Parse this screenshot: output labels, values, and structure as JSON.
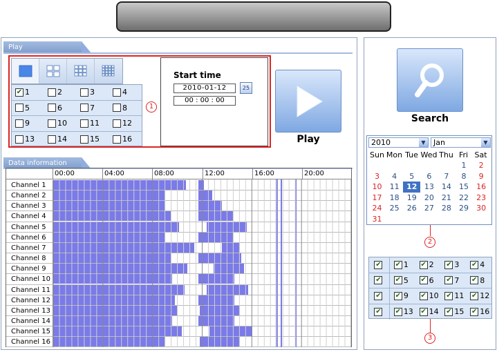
{
  "play_panel": {
    "tab_label": "Play",
    "channels": [
      "1",
      "2",
      "3",
      "4",
      "5",
      "6",
      "7",
      "8",
      "9",
      "10",
      "11",
      "12",
      "13",
      "14",
      "15",
      "16"
    ],
    "channel_checked": [
      true,
      false,
      false,
      false,
      false,
      false,
      false,
      false,
      false,
      false,
      false,
      false,
      false,
      false,
      false,
      false
    ],
    "layout_options": [
      "single-layout-icon",
      "quad-layout-icon",
      "nine-layout-icon",
      "sixteen-layout-icon"
    ],
    "start_time_label": "Start time",
    "start_date": "2010-01-12",
    "start_time": "00 : 00 : 00",
    "calendar_button_label": "25",
    "play_label": "Play",
    "callout_1": "1"
  },
  "data_info": {
    "tab_label": "Data information",
    "hours": [
      "00:00",
      "04:00",
      "08:00",
      "12:00",
      "16:00",
      "20:00"
    ],
    "channels": [
      "Channel 1",
      "Channel 2",
      "Channel 3",
      "Channel 4",
      "Channel 5",
      "Channel 6",
      "Channel 7",
      "Channel 8",
      "Channel 9",
      "Channel 10",
      "Channel 11",
      "Channel 12",
      "Channel 13",
      "Channel 14",
      "Channel 15",
      "Channel 16"
    ],
    "bar_color": "#7a7ae8"
  },
  "right_panel": {
    "search_label": "Search",
    "year": "2010",
    "month": "Jan",
    "weekdays": [
      "Sun",
      "Mon",
      "Tue",
      "Wed",
      "Thu",
      "Fri",
      "Sat"
    ],
    "days": [
      "",
      "",
      "",
      "",
      "",
      "1",
      "2",
      "3",
      "4",
      "5",
      "6",
      "7",
      "8",
      "9",
      "10",
      "11",
      "12",
      "13",
      "14",
      "15",
      "16",
      "17",
      "18",
      "19",
      "20",
      "21",
      "22",
      "23",
      "24",
      "25",
      "26",
      "27",
      "28",
      "29",
      "30",
      "31"
    ],
    "selected_day": "12",
    "callout_2": "2",
    "callout_3": "3",
    "channels": [
      "1",
      "2",
      "3",
      "4",
      "5",
      "6",
      "7",
      "8",
      "9",
      "10",
      "11",
      "12",
      "13",
      "14",
      "15",
      "16"
    ]
  },
  "colors": {
    "accent": "#7a7ae8",
    "callout": "#dd2222",
    "selected_day": "#3f72c3"
  }
}
